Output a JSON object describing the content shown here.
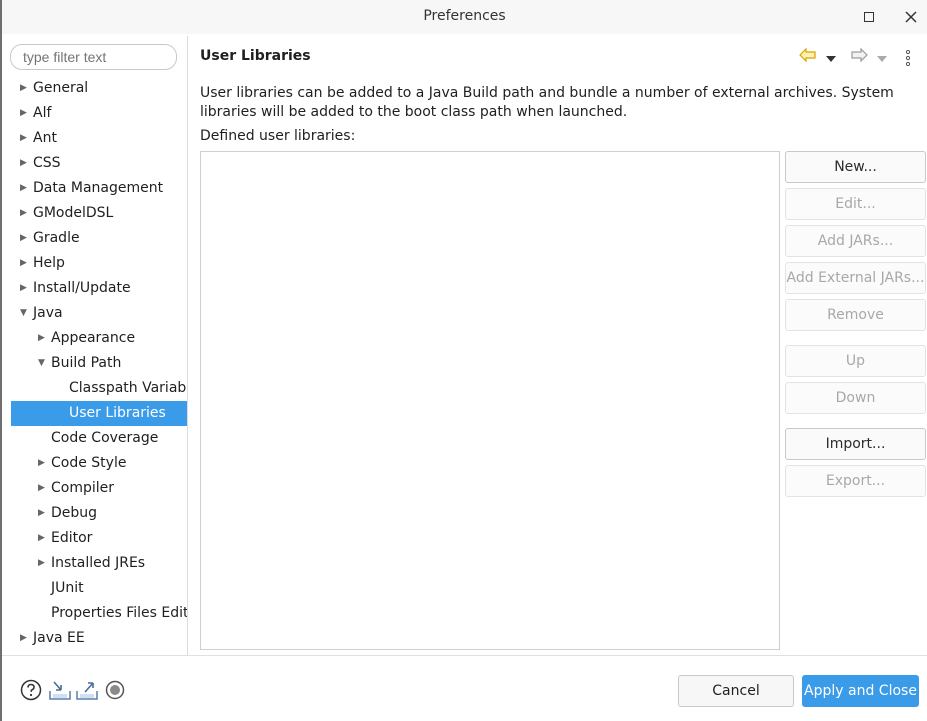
{
  "window": {
    "title": "Preferences",
    "maximize_icon": "maximize-icon",
    "close_icon": "close-icon"
  },
  "filter": {
    "placeholder": "type filter text"
  },
  "tree": [
    {
      "label": "General",
      "level": 0,
      "arrow": "collapsed"
    },
    {
      "label": "Alf",
      "level": 0,
      "arrow": "collapsed"
    },
    {
      "label": "Ant",
      "level": 0,
      "arrow": "collapsed"
    },
    {
      "label": "CSS",
      "level": 0,
      "arrow": "collapsed"
    },
    {
      "label": "Data Management",
      "level": 0,
      "arrow": "collapsed"
    },
    {
      "label": "GModelDSL",
      "level": 0,
      "arrow": "collapsed"
    },
    {
      "label": "Gradle",
      "level": 0,
      "arrow": "collapsed"
    },
    {
      "label": "Help",
      "level": 0,
      "arrow": "collapsed"
    },
    {
      "label": "Install/Update",
      "level": 0,
      "arrow": "collapsed"
    },
    {
      "label": "Java",
      "level": 0,
      "arrow": "expanded"
    },
    {
      "label": "Appearance",
      "level": 1,
      "arrow": "collapsed"
    },
    {
      "label": "Build Path",
      "level": 1,
      "arrow": "expanded"
    },
    {
      "label": "Classpath Variable",
      "level": 2,
      "arrow": "none"
    },
    {
      "label": "User Libraries",
      "level": 2,
      "arrow": "none",
      "selected": true
    },
    {
      "label": "Code Coverage",
      "level": 1,
      "arrow": "none"
    },
    {
      "label": "Code Style",
      "level": 1,
      "arrow": "collapsed"
    },
    {
      "label": "Compiler",
      "level": 1,
      "arrow": "collapsed"
    },
    {
      "label": "Debug",
      "level": 1,
      "arrow": "collapsed"
    },
    {
      "label": "Editor",
      "level": 1,
      "arrow": "collapsed"
    },
    {
      "label": "Installed JREs",
      "level": 1,
      "arrow": "collapsed"
    },
    {
      "label": "JUnit",
      "level": 1,
      "arrow": "none"
    },
    {
      "label": "Properties Files Edito",
      "level": 1,
      "arrow": "none"
    },
    {
      "label": "Java EE",
      "level": 0,
      "arrow": "collapsed"
    }
  ],
  "page": {
    "title": "User Libraries",
    "description": "User libraries can be added to a Java Build path and bundle a number of external archives. System libraries will be added to the boot class path when launched.",
    "defined_label": "Defined user libraries:"
  },
  "buttons": [
    {
      "label": "New...",
      "enabled": true
    },
    {
      "label": "Edit...",
      "enabled": false
    },
    {
      "label": "Add JARs...",
      "enabled": false
    },
    {
      "label": "Add External JARs...",
      "enabled": false
    },
    {
      "label": "Remove",
      "enabled": false
    },
    {
      "label": "Up",
      "enabled": false
    },
    {
      "label": "Down",
      "enabled": false
    },
    {
      "label": "Import...",
      "enabled": true
    },
    {
      "label": "Export...",
      "enabled": false
    }
  ],
  "footer": {
    "cancel": "Cancel",
    "apply_close": "Apply and Close"
  },
  "colors": {
    "accent": "#3a9be8",
    "back_arrow": "#d9a300"
  }
}
